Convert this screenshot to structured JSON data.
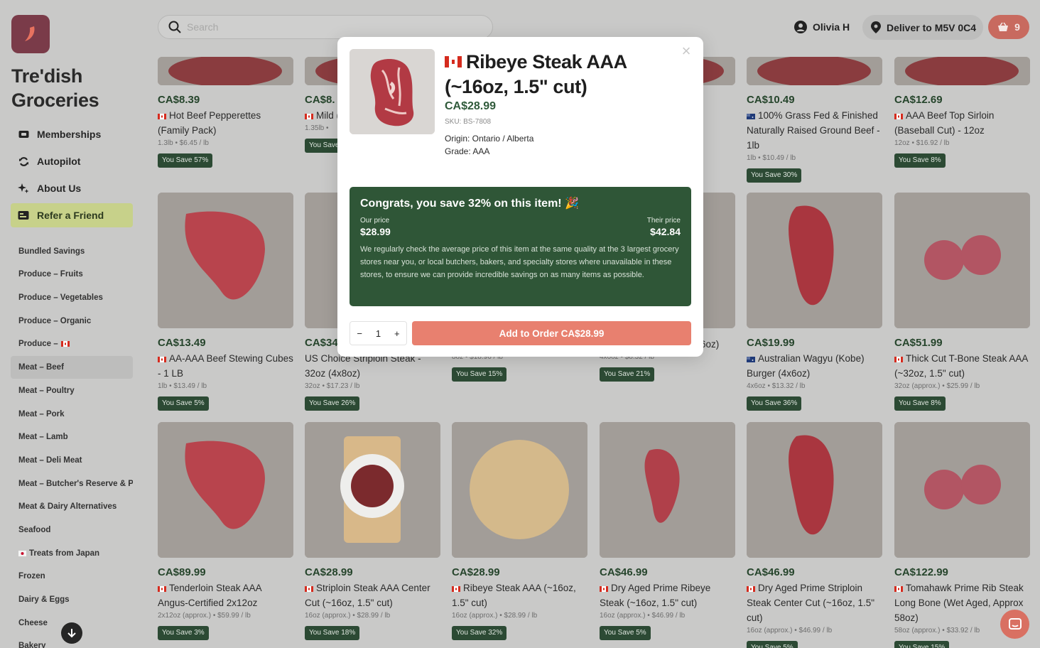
{
  "brand": {
    "name": "Tre'dish Groceries",
    "logo_icon": "chili-logo-icon",
    "logo_color": "#7a3b49"
  },
  "nav": [
    {
      "label": "Memberships",
      "icon": "membership-icon"
    },
    {
      "label": "Autopilot",
      "icon": "refresh-icon"
    },
    {
      "label": "About Us",
      "icon": "sparkle-icon"
    },
    {
      "label": "Refer a Friend",
      "icon": "gift-card-icon"
    }
  ],
  "categories": [
    "Bundled Savings",
    "Produce – Fruits",
    "Produce – Vegetables",
    "Produce – Organic",
    "Produce – ",
    "Meat – Beef",
    "Meat – Poultry",
    "Meat – Pork",
    "Meat – Lamb",
    "Meat – Deli Meat",
    "Meat – Butcher's Reserve & P",
    "Meat & Dairy Alternatives",
    "Seafood",
    "Treats from Japan",
    "Frozen",
    "Dairy & Eggs",
    "Cheese",
    "Bakery"
  ],
  "search": {
    "placeholder": "Search"
  },
  "user": {
    "name": "Olivia H"
  },
  "delivery": {
    "label": "Deliver to M5V 0C4"
  },
  "cart": {
    "count": "9"
  },
  "colors": {
    "accent": "#e8806f",
    "green": "#2f5637",
    "price_green": "#26452c"
  },
  "products": [
    {
      "price": "CA$8.39",
      "name": "Hot Beef Pepperettes (Family Pack)",
      "meta": "1.3lb  •  $6.45 / lb",
      "save": "You Save 57%",
      "flag": "ca"
    },
    {
      "price": "CA$8.",
      "name": "Mild (Family",
      "meta": "1.35lb  •",
      "save": "You Save",
      "flag": "ca"
    },
    {
      "price": "",
      "name": "ean -",
      "meta": "",
      "save": "",
      "flag": ""
    },
    {
      "price": "CA$10.49",
      "name": "100% Grass Fed & Finished Naturally Raised Ground Beef - 1lb",
      "meta": "1lb  •  $10.49 / lb",
      "save": "You Save 30%",
      "flag": "au"
    },
    {
      "price": "CA$12.69",
      "name": "AAA Beef Top Sirloin (Baseball Cut) - 12oz",
      "meta": "12oz  •  $16.92 / lb",
      "save": "You Save 8%",
      "flag": "ca"
    },
    {
      "price": "CA$13.49",
      "name": "AA-AAA Beef Stewing Cubes - 1 LB",
      "meta": "1lb  •  $13.49 / lb",
      "save": "You Save 5%",
      "flag": "ca"
    },
    {
      "price": "CA$34",
      "name": "US Choice Striploin Steak - 32oz (4x8oz)",
      "meta": "32oz  •  $17.23 / lb",
      "save": "You Save 26%",
      "flag": ""
    },
    {
      "price": "",
      "name": "US Choice Striploin Steak - 8oz",
      "meta": "8oz  •  $18.96 / lb",
      "save": "You Save 15%",
      "flag": ""
    },
    {
      "price": "",
      "name": "Prime Rib Burger (4x6oz)",
      "meta": "4x6oz  •  $8.32 / lb",
      "save": "You Save 21%",
      "flag": "ca"
    },
    {
      "price": "CA$19.99",
      "name": "Australian Wagyu (Kobe) Burger (4x6oz)",
      "meta": "4x6oz  •  $13.32 / lb",
      "save": "You Save 36%",
      "flag": "au"
    },
    {
      "price": "CA$51.99",
      "name": "Thick Cut T-Bone Steak AAA (~32oz, 1.5\" cut)",
      "meta": "32oz (approx.)  •  $25.99 / lb",
      "save": "You Save 8%",
      "flag": "ca"
    },
    {
      "price": "CA$89.99",
      "name": "Tenderloin Steak AAA Angus-Certified 2x12oz",
      "meta": "2x12oz (approx.)  •  $59.99 / lb",
      "save": "You Save 3%",
      "flag": "ca"
    },
    {
      "price": "CA$28.99",
      "name": "Striploin Steak AAA Center Cut (~16oz, 1.5\" cut)",
      "meta": "16oz (approx.)  •  $28.99 / lb",
      "save": "You Save 18%",
      "flag": "ca"
    },
    {
      "price": "CA$28.99",
      "name": "Ribeye Steak AAA (~16oz, 1.5\" cut)",
      "meta": "16oz (approx.)  •  $28.99 / lb",
      "save": "You Save 32%",
      "flag": "ca"
    },
    {
      "price": "CA$46.99",
      "name": "Dry Aged Prime Ribeye Steak (~16oz, 1.5\" cut)",
      "meta": "16oz (approx.)  •  $46.99 / lb",
      "save": "You Save 5%",
      "flag": "ca"
    },
    {
      "price": "CA$46.99",
      "name": "Dry Aged Prime Striploin Steak Center Cut (~16oz, 1.5\" cut)",
      "meta": "16oz (approx.)  •  $46.99 / lb",
      "save": "You Save 5%",
      "flag": "ca"
    },
    {
      "price": "CA$122.99",
      "name": "Tomahawk Prime Rib Steak Long Bone (Wet Aged, Approx 58oz)",
      "meta": "58oz (approx.)  •  $33.92 / lb",
      "save": "You Save 15%",
      "flag": "ca"
    }
  ],
  "modal": {
    "title": "Ribeye Steak AAA (~16oz, 1.5\" cut)",
    "price": "CA$28.99",
    "sku": "SKU: BS-7808",
    "origin": "Origin: Ontario / Alberta",
    "grade": "Grade: AAA",
    "congrats_title": "Congrats, you save 32% on this item! 🎉",
    "our_price_label": "Our price",
    "our_price": "$28.99",
    "their_price_label": "Their price",
    "their_price": "$42.84",
    "description": "We regularly check the average price of this item at the same quality at the 3 largest grocery stores near you, or local butchers, bakers, and specialty stores where unavailable in these stores, to ensure we can provide incredible savings on as many items as possible.",
    "qty_minus": "−",
    "qty": "1",
    "qty_plus": "+",
    "add_label": "Add to Order CA$28.99",
    "close": "×"
  }
}
